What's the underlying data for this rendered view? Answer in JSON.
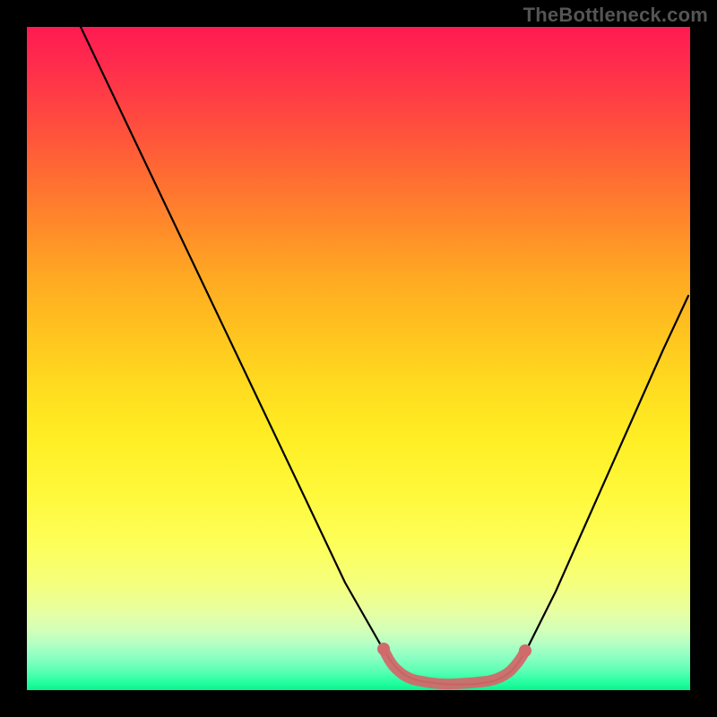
{
  "attribution": "TheBottleneck.com",
  "colors": {
    "frame_bg": "#000000",
    "attribution_text": "#555555",
    "curve_stroke": "#000000",
    "bottom_highlight": "#d16a6a",
    "gradient_top": "#ff1a52",
    "gradient_mid": "#ffee24",
    "gradient_bottom": "#06f58e"
  },
  "chart_data": {
    "type": "line",
    "title": "",
    "xlabel": "",
    "ylabel": "",
    "xlim": [
      0,
      100
    ],
    "ylim": [
      0,
      100
    ],
    "grid": false,
    "legend": false,
    "series": [
      {
        "name": "bottleneck_curve",
        "x": [
          8,
          15,
          22,
          28,
          35,
          42,
          48,
          53,
          59,
          65,
          70,
          76,
          80,
          85,
          91,
          96,
          100
        ],
        "y": [
          100,
          86,
          72,
          57,
          43,
          29,
          16,
          7,
          1.5,
          0.5,
          1.5,
          7,
          15,
          27,
          39,
          51,
          59
        ]
      }
    ],
    "highlight_range": {
      "description": "flat bottom of curve (optimal zone)",
      "x_start": 54,
      "x_end": 75,
      "color": "#d16a6a"
    },
    "background": {
      "type": "vertical_gradient",
      "meaning": "value 100 = red (worst), value 0 = green (best)",
      "stops": [
        {
          "value": 100,
          "color": "#ff1a52"
        },
        {
          "value": 50,
          "color": "#ffee24"
        },
        {
          "value": 0,
          "color": "#06f58e"
        }
      ]
    }
  }
}
